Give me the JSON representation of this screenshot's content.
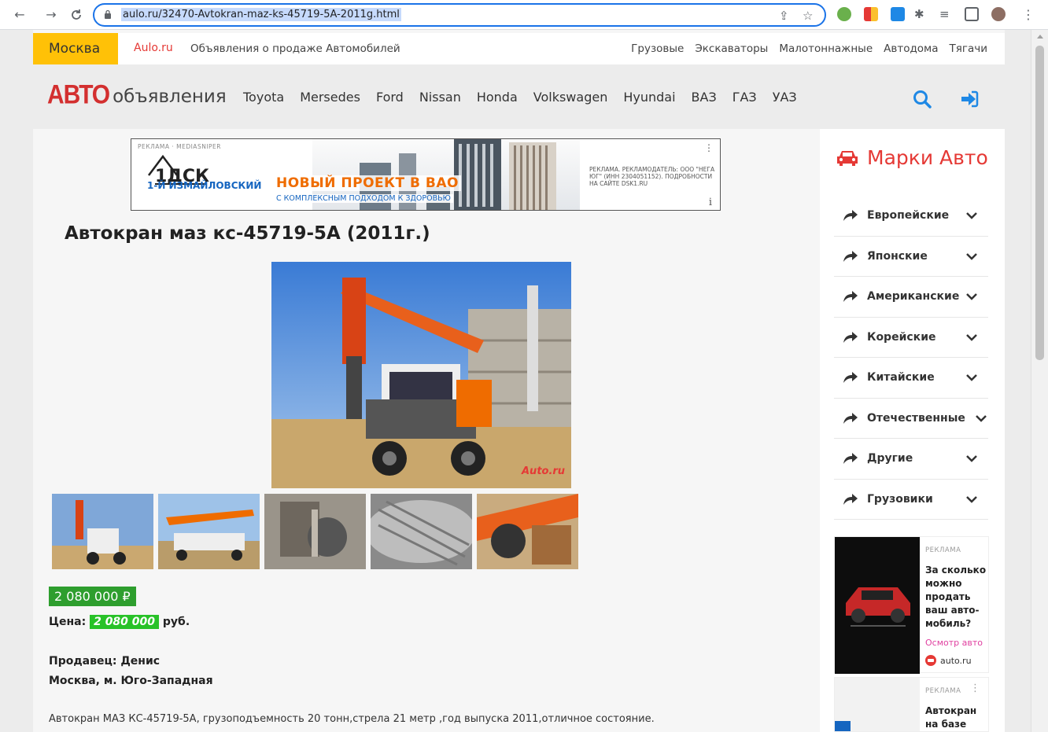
{
  "browser": {
    "url": "aulo.ru/32470-Avtokran-maz-ks-45719-5A-2011g.html"
  },
  "topbar": {
    "city": "Москва",
    "brand": "Aulo.ru",
    "tagline": "Объявления о продаже Автомобилей",
    "links": [
      "Грузовые",
      "Экскаваторы",
      "Малотоннажные",
      "Автодома",
      "Тягачи"
    ]
  },
  "header": {
    "logo_bold": "АВТО",
    "logo_rest": "объявления",
    "brands": [
      "Toyota",
      "Mersedes",
      "Ford",
      "Nissan",
      "Honda",
      "Volkswagen",
      "Hyundai",
      "ВАЗ",
      "ГАЗ",
      "УАЗ"
    ]
  },
  "ad_banner": {
    "label": "РЕКЛАМА · MEDIASNIPER",
    "logo_text": "1ДСК",
    "sub": "1-Й ИЗМАЙЛОВСКИЙ",
    "headline": "НОВЫЙ ПРОЕКТ В ВАО",
    "tag": "С КОМПЛЕКСНЫМ ПОДХОДОМ К ЗДОРОВЬЮ",
    "disclaimer": "РЕКЛАМА. РЕКЛАМОДАТЕЛЬ: ООО \"НЕГА ЮГ\" (ИНН 2304051152). ПОДРОБНОСТИ НА САЙТЕ DSK1.RU",
    "info": "i"
  },
  "listing": {
    "title": "Автокран маз кс-45719-5А (2011г.)",
    "price_badge": "2 080 000 ₽",
    "price_label": "Цена:",
    "price_value": "2 080 000",
    "price_unit": "руб.",
    "seller": "Продавец:  Денис",
    "location": "Москва, м. Юго-Западная",
    "description": "Автокран МАЗ КС-45719-5А, грузоподъемность 20 тонн,стрела 21 метр ,год выпуска 2011,отличное состояние.",
    "photo_watermark": "Аuto.ru"
  },
  "sidebar": {
    "title": "Марки Авто",
    "items": [
      "Европейские",
      "Японские",
      "Американские",
      "Корейские",
      "Китайские",
      "Отечественные",
      "Другие",
      "Грузовики"
    ],
    "ad1": {
      "label": "РЕКЛАМА",
      "headline": "За сколько можно продать ваш авто-мобиль?",
      "cta": "Осмотр авто",
      "source": "auto.ru"
    },
    "ad2": {
      "label": "РЕКЛАМА",
      "headline": "Автокран на базе"
    }
  },
  "colors": {
    "accent_red": "#e53935",
    "city_yellow": "#ffc107",
    "price_green": "#2e9e2e",
    "link_blue": "#1e88e5"
  }
}
